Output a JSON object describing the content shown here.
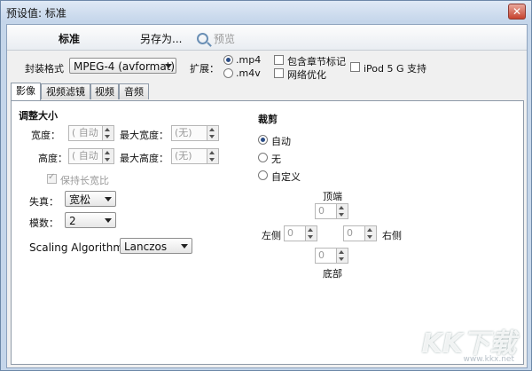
{
  "window": {
    "title": "预设值: 标准",
    "close_glyph": "✕"
  },
  "toolbar": {
    "preset_name": "标准",
    "save_as": "另存为...",
    "preview": "预览"
  },
  "container": {
    "format_label": "封装格式",
    "format_value": "MPEG-4 (avformat)",
    "extension_label": "扩展：",
    "ext_mp4": ".mp4",
    "ext_m4v": ".m4v",
    "chapter_markers": "包含章节标记",
    "web_optimized": "网络优化",
    "ipod_support": "iPod 5 G 支持"
  },
  "tabs": [
    "影像",
    "视频滤镜",
    "视频",
    "音频"
  ],
  "picture": {
    "resize_title": "调整大小",
    "width_label": "宽度：",
    "width_value": "( 自动",
    "max_width_label": "最大宽度：",
    "max_width_value": "(无)",
    "height_label": "高度：",
    "height_value": "( 自动",
    "max_height_label": "最大高度：",
    "max_height_value": "(无)",
    "keep_aspect": "保持长宽比",
    "anamorphic_label": "失真：",
    "anamorphic_value": "宽松",
    "modulus_label": "模数：",
    "modulus_value": "2",
    "scaling_label": "Scaling Algorithm:",
    "scaling_value": "Lanczos"
  },
  "crop": {
    "title": "裁剪",
    "auto": "自动",
    "none": "无",
    "custom": "自定义",
    "top_label": "顶端",
    "left_label": "左侧",
    "right_label": "右侧",
    "bottom_label": "底部",
    "top_value": "0",
    "left_value": "0",
    "right_value": "0",
    "bottom_value": "0"
  },
  "watermark": {
    "text": "KK下载",
    "url": "www.kkx.net"
  }
}
